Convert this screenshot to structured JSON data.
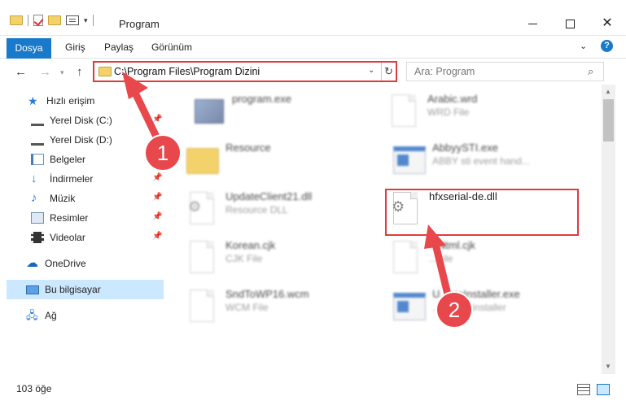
{
  "window": {
    "title": "Program",
    "min_icon": "minimize-icon",
    "max_icon": "maximize-icon",
    "close_icon": "close-icon"
  },
  "ribbon": {
    "tabs": [
      {
        "label": "Dosya",
        "active": true
      },
      {
        "label": "Giriş"
      },
      {
        "label": "Paylaş"
      },
      {
        "label": "Görünüm"
      }
    ],
    "help_label": "?"
  },
  "address": {
    "path": "C:\\Program Files\\Program Dizini",
    "search_placeholder": "Ara: Program"
  },
  "sidebar": {
    "items": [
      {
        "label": "Hızlı erişim",
        "icon": "star-icon"
      },
      {
        "label": "Yerel Disk (C:)",
        "icon": "disk-icon",
        "pinned": true
      },
      {
        "label": "Yerel Disk (D:)",
        "icon": "disk-icon"
      },
      {
        "label": "Belgeler",
        "icon": "documents-icon"
      },
      {
        "label": "İndirmeler",
        "icon": "download-icon",
        "pinned": true
      },
      {
        "label": "Müzik",
        "icon": "music-icon",
        "pinned": true
      },
      {
        "label": "Resimler",
        "icon": "pictures-icon",
        "pinned": true
      },
      {
        "label": "Videolar",
        "icon": "videos-icon",
        "pinned": true
      },
      {
        "label": "OneDrive",
        "icon": "cloud-icon"
      },
      {
        "label": "Bu bilgisayar",
        "icon": "computer-icon",
        "selected": true
      },
      {
        "label": "Ağ",
        "icon": "network-icon"
      }
    ]
  },
  "files": [
    {
      "name": "program.exe",
      "type": "",
      "icon": "installer-icon"
    },
    {
      "name": "Arabic.wrd",
      "type": "WRD File",
      "icon": "document-icon"
    },
    {
      "name": "Resource",
      "type": "",
      "icon": "folder-icon"
    },
    {
      "name": "AbbyySTI.exe",
      "type": "ABBY sti event hand...",
      "icon": "application-icon"
    },
    {
      "name": "UpdateClient21.dll",
      "type": "Resource DLL",
      "icon": "dll-icon"
    },
    {
      "name": "hfxserial-de.dll",
      "type": "",
      "icon": "dll-icon"
    },
    {
      "name": "Korean.cjk",
      "type": "CJK File",
      "icon": "document-icon"
    },
    {
      "name": "...Ntml.cjk",
      "type": "...File",
      "icon": "document-icon"
    },
    {
      "name": "SndToWP16.wcm",
      "type": "WCM File",
      "icon": "document-icon"
    },
    {
      "name": "U...ateInstaller.exe",
      "type": "...pdates installer",
      "icon": "application-icon"
    }
  ],
  "annotations": [
    "1",
    "2"
  ],
  "status": {
    "item_count": "103 öğe"
  },
  "colors": {
    "accent": "#1979ca",
    "highlight_red": "#e03c3c",
    "selected_bg": "#cce8ff"
  }
}
